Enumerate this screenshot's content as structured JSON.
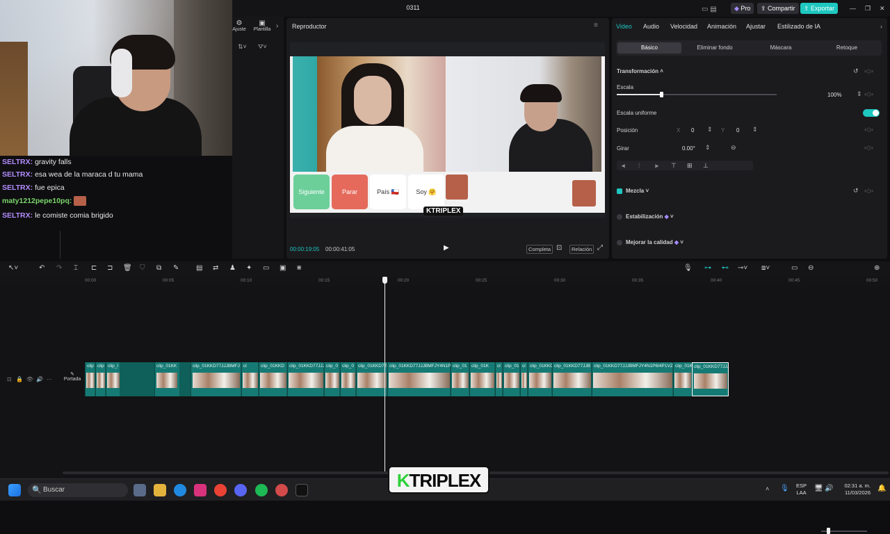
{
  "window": {
    "title": "0311",
    "pro_label": "Pro",
    "share_label": "Compartir",
    "export_label": "Exportar"
  },
  "chat": {
    "lines": [
      {
        "user": "SELTRX:",
        "msg": "gravity falls",
        "color": "#b38cff"
      },
      {
        "user": "SELTRX:",
        "msg": "esa wea de la maraca d tu mama",
        "color": "#b38cff"
      },
      {
        "user": "SELTRX:",
        "msg": "fue epica",
        "color": "#b38cff"
      },
      {
        "user": "maty1212pepe10pq:",
        "msg": "",
        "color": "#7bd66b"
      },
      {
        "user": "SELTRX:",
        "msg": "le comiste comia brigido",
        "color": "#b38cff"
      }
    ]
  },
  "left_panel": {
    "ajuste": "Ajuste",
    "plantillas": "Plantilla"
  },
  "player": {
    "title": "Reproductor",
    "buttons": {
      "siguiente": "Siguiente",
      "parar": "Parar",
      "pais": "País 🇨🇱",
      "soy": "Soy 🤗"
    },
    "current_time": "00:00:19:05",
    "total_time": "00:00:41:05",
    "complete_label": "Completa",
    "ratio_label": "Relación",
    "stream_watermark": "KTRIPLEX"
  },
  "inspector": {
    "tabs": [
      "Video",
      "Audio",
      "Velocidad",
      "Animación",
      "Ajustar",
      "Estilizado de IA"
    ],
    "subtabs": [
      "Básico",
      "Eliminar fondo",
      "Máscara",
      "Retoque"
    ],
    "transform_label": "Transformación",
    "scale_label": "Escala",
    "scale_value": "100%",
    "scale_fraction": 0.28,
    "uniform_scale_label": "Escala uniforme",
    "position_label": "Posición",
    "pos_x_label": "X",
    "pos_x": "0",
    "pos_y_label": "Y",
    "pos_y": "0",
    "rotate_label": "Girar",
    "rotate_value": "0.00°",
    "blend_label": "Mezcla",
    "stabilization_label": "Estabilización",
    "quality_label": "Mejorar la calidad"
  },
  "timeline": {
    "ticks": [
      "00:00",
      "00:05",
      "00:10",
      "00:15",
      "00:20",
      "00:25",
      "00:30",
      "00:35",
      "00:40",
      "00:45",
      "00:50"
    ],
    "cover_label": "Portada",
    "clips": [
      "clip",
      "clip",
      "clip_l",
      "clip_01KK",
      "clip_01KKD77JJJBMFJ",
      "cl",
      "clip_01KKD",
      "clip_01KKD77JJJ",
      "clip_0",
      "clip_0",
      "clip_01KKD77JJ",
      "clip_01KKD77JJJBMFJY4N1P6",
      "clip_01",
      "clip_01K",
      "cl",
      "clip_01",
      "cl",
      "clip_01KKD",
      "clip_01KKD77JJB",
      "clip_01KKD77JJJBMFJY4N1P6I4P1VZ0J",
      "clip_01K",
      "clip_01KKD77JJJ"
    ]
  },
  "taskbar": {
    "search_placeholder": "Buscar",
    "lang1": "ESP",
    "lang2": "LAA",
    "time": "02:31 a. m.",
    "date": "11/03/2026"
  },
  "overlay": {
    "brand": "KTRIPLEX",
    "brand_k": "K",
    "brand_rest": "TRIPLEX"
  }
}
